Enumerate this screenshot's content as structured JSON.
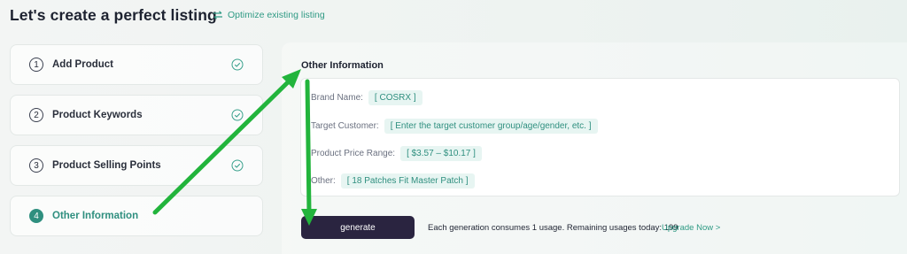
{
  "header": {
    "title": "Let's create a perfect listing",
    "optimize_link": "Optimize existing listing"
  },
  "steps": [
    {
      "number": "1",
      "label": "Add Product",
      "completed": true
    },
    {
      "number": "2",
      "label": "Product Keywords",
      "completed": true
    },
    {
      "number": "3",
      "label": "Product Selling Points",
      "completed": true
    },
    {
      "number": "4",
      "label": "Other Information",
      "completed": false,
      "active": true
    }
  ],
  "panel": {
    "title": "Other Information",
    "fields": [
      {
        "label": "Brand Name:",
        "value": "[   COSRX  ]"
      },
      {
        "label": "Target Customer:",
        "value": "[   Enter the target customer group/age/gender, etc.  ]"
      },
      {
        "label": "Product Price Range:",
        "value": "[   $3.57 – $10.17  ]"
      },
      {
        "label": "Other:",
        "value": "[   18 Patches Fit Master Patch  ]"
      }
    ]
  },
  "footer": {
    "generate_label": "generate",
    "usage_text": "Each generation consumes 1 usage. Remaining usages today: 199",
    "upgrade_label": "Upgrade Now >"
  },
  "colors": {
    "accent": "#2f8f7f",
    "button": "#2a2440",
    "annotation_arrow": "#22b43c"
  }
}
